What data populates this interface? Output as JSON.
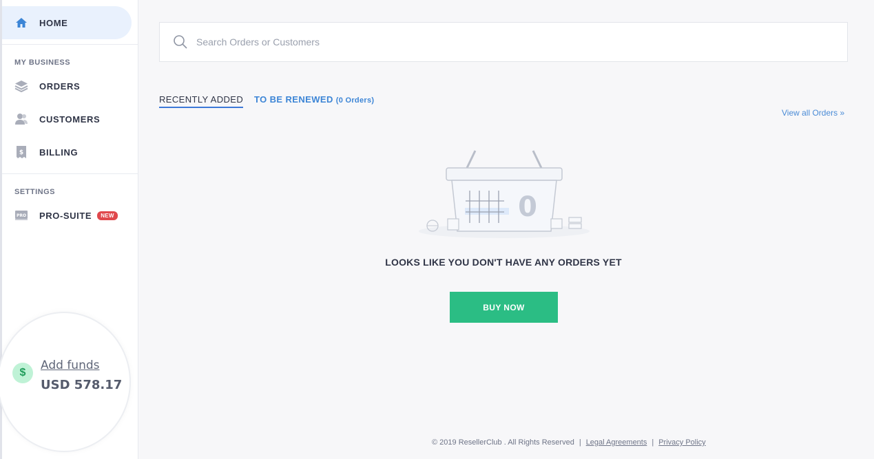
{
  "sidebar": {
    "home_label": "HOME",
    "section_business": "MY BUSINESS",
    "items": [
      {
        "label": "ORDERS",
        "icon": "layers-icon"
      },
      {
        "label": "CUSTOMERS",
        "icon": "users-icon"
      },
      {
        "label": "BILLING",
        "icon": "invoice-icon"
      }
    ],
    "section_settings": "SETTINGS",
    "pro_suite": {
      "label": "PRO-SUITE",
      "badge": "NEW"
    },
    "funds": {
      "add_label": "Add funds",
      "balance": "USD 578.17",
      "symbol": "$"
    }
  },
  "search": {
    "placeholder": "Search Orders or Customers"
  },
  "tabs": {
    "recent": "RECENTLY ADDED",
    "renew": "TO BE RENEWED",
    "renew_count": "(0 Orders)"
  },
  "view_all": "View all Orders »",
  "empty": {
    "basket_count": "0",
    "message": "LOOKS LIKE YOU DON'T HAVE ANY ORDERS YET",
    "button": "BUY NOW"
  },
  "footer": {
    "copyright": "© 2019 ResellerClub . All Rights Reserved",
    "legal": "Legal Agreements",
    "privacy": "Privacy Policy"
  },
  "colors": {
    "accent": "#3c85d6",
    "buy_button": "#2bbd84",
    "new_badge": "#e0484c",
    "home_bg": "#e9f1fd"
  }
}
